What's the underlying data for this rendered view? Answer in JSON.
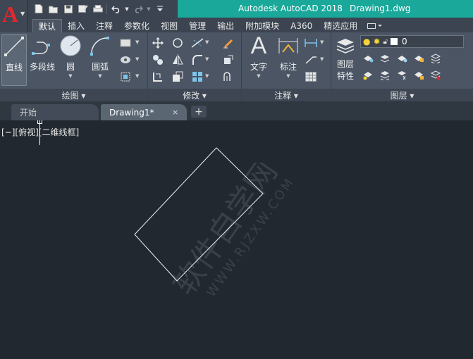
{
  "titlebar": {
    "app_logo": "A",
    "app_title": "Autodesk AutoCAD 2018",
    "doc_title": "Drawing1.dwg"
  },
  "qat": [
    "new-icon",
    "open-icon",
    "save-icon",
    "saveas-icon",
    "plot-icon",
    "undo-icon",
    "redo-icon",
    "dropdown-icon"
  ],
  "ribbon_tabs": [
    {
      "label": "默认",
      "active": true
    },
    {
      "label": "插入"
    },
    {
      "label": "注释"
    },
    {
      "label": "参数化"
    },
    {
      "label": "视图"
    },
    {
      "label": "管理"
    },
    {
      "label": "输出"
    },
    {
      "label": "附加模块"
    },
    {
      "label": "A360"
    },
    {
      "label": "精选应用"
    }
  ],
  "panels": {
    "draw": {
      "title": "绘图 ▾",
      "line": "直线",
      "polyline": "多段线",
      "circle": "圆",
      "arc": "圆弧"
    },
    "modify": {
      "title": "修改 ▾"
    },
    "annotation": {
      "title": "注释 ▾",
      "text": "文字",
      "dimension": "标注"
    },
    "layers": {
      "title": "图层 ▾",
      "properties_line1": "图层",
      "properties_line2": "特性",
      "current_layer": "0"
    }
  },
  "filetabs": {
    "start": "开始",
    "drawing": "Drawing1*",
    "close": "×",
    "add": "+"
  },
  "canvas": {
    "viewport_label": "[−][俯视][二维线框]",
    "watermark_cn": "软件自学网",
    "watermark_en": "WWW.RJZXW.COM"
  },
  "colors": {
    "title_accent": "#1aa89a",
    "logo_red": "#e0282e",
    "canvas_bg": "#212830",
    "ribbon_bg": "#4b5564"
  }
}
